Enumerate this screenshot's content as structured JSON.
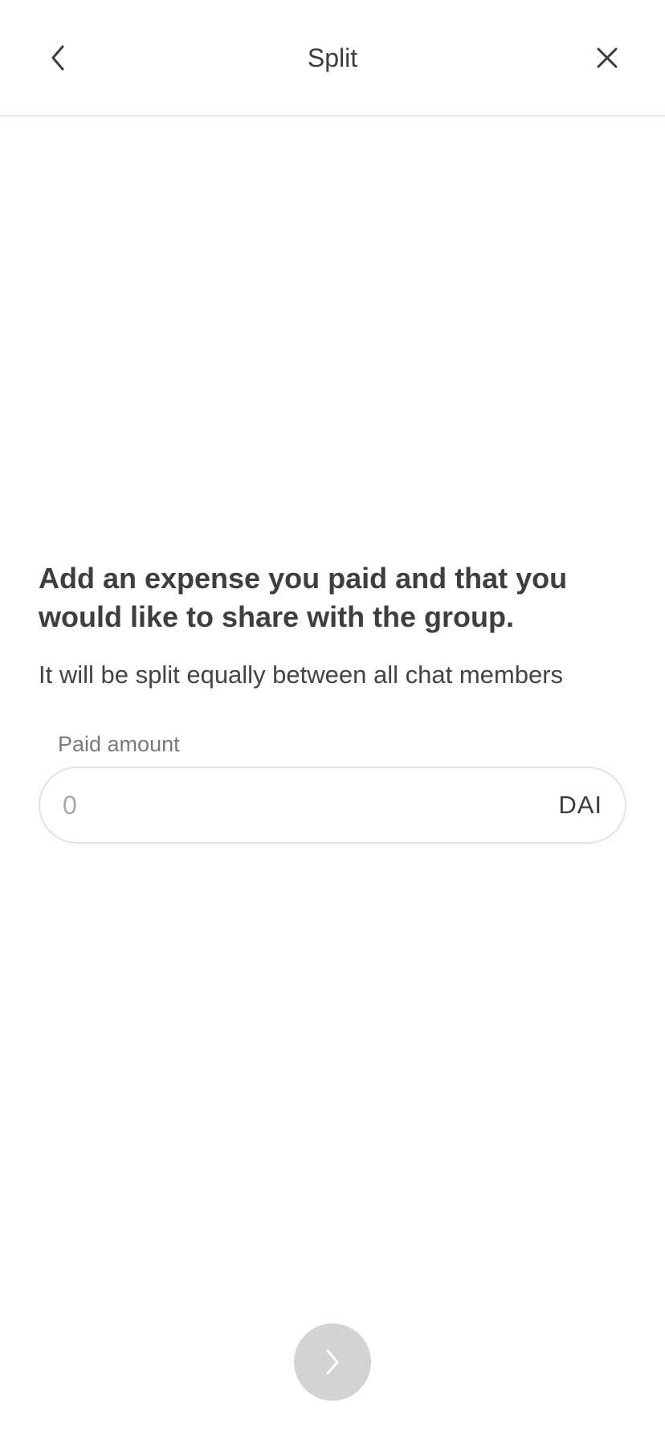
{
  "header": {
    "title": "Split",
    "back_icon": "chevron-left-icon",
    "close_icon": "close-icon"
  },
  "main": {
    "headline": "Add an expense you paid and that you would like to share with the group.",
    "subtext": "It will be split equally between all chat members",
    "amount": {
      "label": "Paid amount",
      "placeholder": "0",
      "value": "",
      "currency": "DAI"
    }
  },
  "footer": {
    "next_icon": "chevron-right-icon"
  },
  "colors": {
    "text": "#3c3c3c",
    "muted": "#7a7a7a",
    "border": "#e3e3e3",
    "disabled_button": "#d3d3d3"
  }
}
